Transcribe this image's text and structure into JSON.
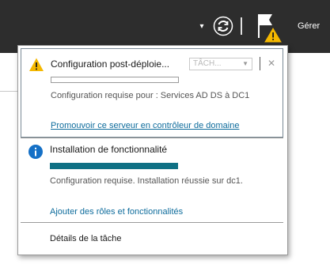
{
  "toolbar": {
    "manage_label": "Gérer",
    "dropdown_icon": "caret-down-icon",
    "refresh_icon": "refresh-icon",
    "notification_icon": "flag-warning-icon"
  },
  "notifications": [
    {
      "icon": "warning-icon",
      "title": "Configuration post-déploie...",
      "task_select_label": "TÂCH...",
      "progress": 0,
      "description": "Configuration requise pour : Services AD DS à DC1",
      "link": "Promouvoir ce serveur en contrôleur de domaine"
    },
    {
      "icon": "info-icon",
      "title": "Installation de fonctionnalité",
      "progress": 1,
      "description": "Configuration requise. Installation réussie sur dc1.",
      "link": "Ajouter des rôles et fonctionnalités"
    }
  ],
  "footer": {
    "task_details": "Détails de la tâche"
  },
  "colors": {
    "toolbar_bg": "#2d2d2d",
    "progress_fill": "#0f7084",
    "link": "#0e6c9c",
    "warning": "#f5b800",
    "info": "#1570c6"
  }
}
